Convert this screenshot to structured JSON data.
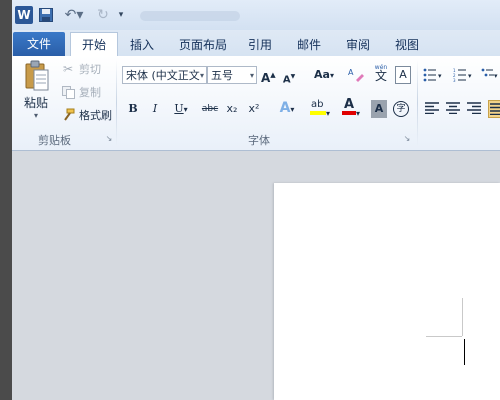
{
  "quick_access": {
    "app_logo": "W",
    "icons": [
      "word-icon",
      "save-icon",
      "undo-icon",
      "redo-icon",
      "customize-dropdown-icon"
    ]
  },
  "tabs": [
    {
      "label": "文件"
    },
    {
      "label": "开始"
    },
    {
      "label": "插入"
    },
    {
      "label": "页面布局"
    },
    {
      "label": "引用"
    },
    {
      "label": "邮件"
    },
    {
      "label": "审阅"
    },
    {
      "label": "视图"
    }
  ],
  "clipboard": {
    "paste_label": "粘贴",
    "cut_label": "剪切",
    "copy_label": "复制",
    "format_painter_label": "格式刷",
    "group_label": "剪贴板"
  },
  "font": {
    "font_name": "宋体 (中文正文",
    "font_size": "五号",
    "grow_glyph": "A",
    "shrink_glyph": "A",
    "change_case_glyph": "Aa",
    "bold": "B",
    "italic": "I",
    "underline": "U",
    "strike": "abc",
    "subscript": "x₂",
    "superscript": "x²",
    "text_effect_glyph": "A",
    "highlight_glyph": "ab",
    "font_color_glyph": "A",
    "char_shading_glyph": "A",
    "enclose_glyph": "字",
    "border_glyph": "A",
    "pinyin_glyph": "文",
    "group_label": "字体"
  },
  "colors": {
    "file_tab": "#2a5ea8",
    "highlight_yellow": "#ffff00",
    "font_red": "#e00000"
  }
}
